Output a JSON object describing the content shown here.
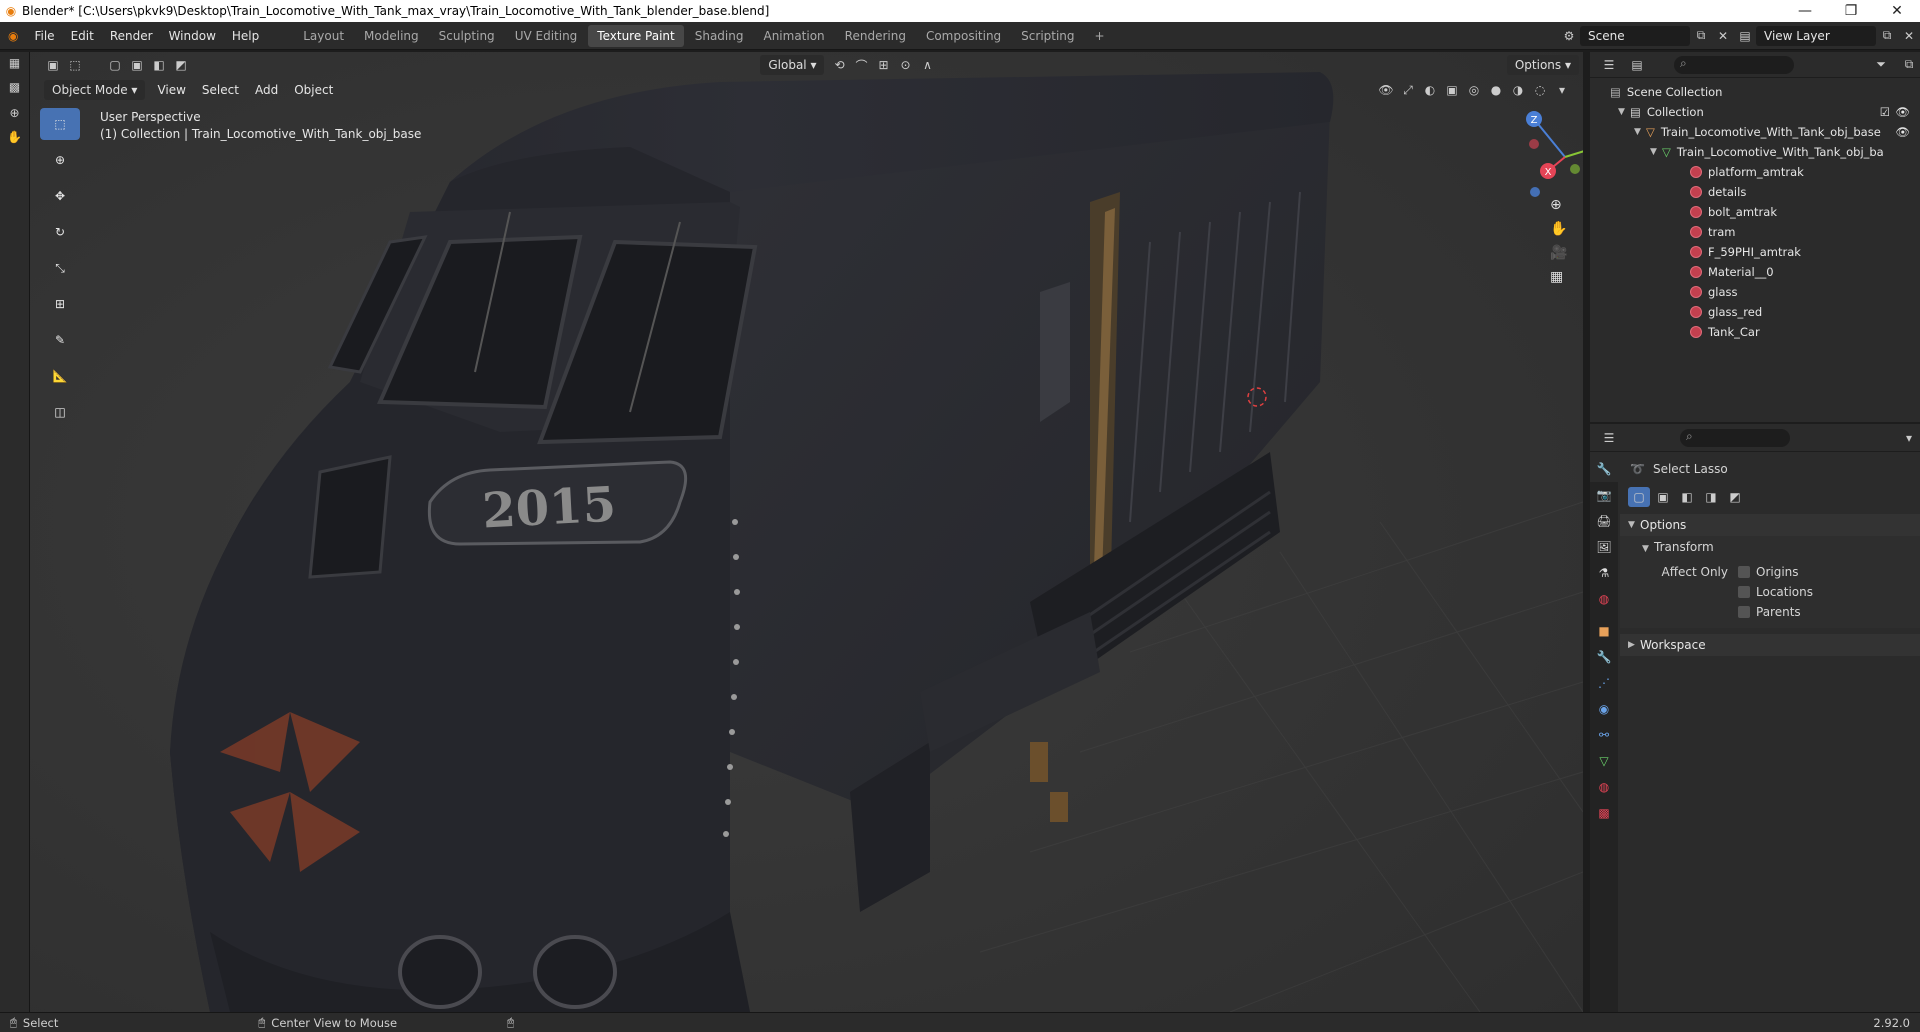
{
  "window": {
    "title": "Blender* [C:\\Users\\pkvk9\\Desktop\\Train_Locomotive_With_Tank_max_vray\\Train_Locomotive_With_Tank_blender_base.blend]"
  },
  "menu": [
    "File",
    "Edit",
    "Render",
    "Window",
    "Help"
  ],
  "workspaces": [
    "Layout",
    "Modeling",
    "Sculpting",
    "UV Editing",
    "Texture Paint",
    "Shading",
    "Animation",
    "Rendering",
    "Compositing",
    "Scripting"
  ],
  "active_workspace": "Texture Paint",
  "scene": "Scene",
  "view_layer": "View Layer",
  "viewport": {
    "mode": "Object Mode",
    "menus": [
      "View",
      "Select",
      "Add",
      "Object"
    ],
    "orientation": "Global",
    "options": "Options",
    "info_line1": "User Perspective",
    "info_line2": "(1) Collection | Train_Locomotive_With_Tank_obj_base",
    "loco_number": "2015",
    "gizmo": {
      "x": "X",
      "y": "Y",
      "z": "Z"
    }
  },
  "outliner": {
    "root": "Scene Collection",
    "collection": "Collection",
    "object": "Train_Locomotive_With_Tank_obj_base",
    "mesh": "Train_Locomotive_With_Tank_obj_ba",
    "materials": [
      "platform_amtrak",
      "details",
      "bolt_amtrak",
      "tram",
      "F_59PHI_amtrak",
      "Material__0",
      "glass",
      "glass_red",
      "Tank_Car"
    ]
  },
  "properties": {
    "tool_name": "Select Lasso",
    "options": "Options",
    "transform": "Transform",
    "affect_only": "Affect Only",
    "checks": [
      "Origins",
      "Locations",
      "Parents"
    ],
    "workspace": "Workspace"
  },
  "status": {
    "left": "Select",
    "middle": "Center View to Mouse",
    "version": "2.92.0"
  }
}
